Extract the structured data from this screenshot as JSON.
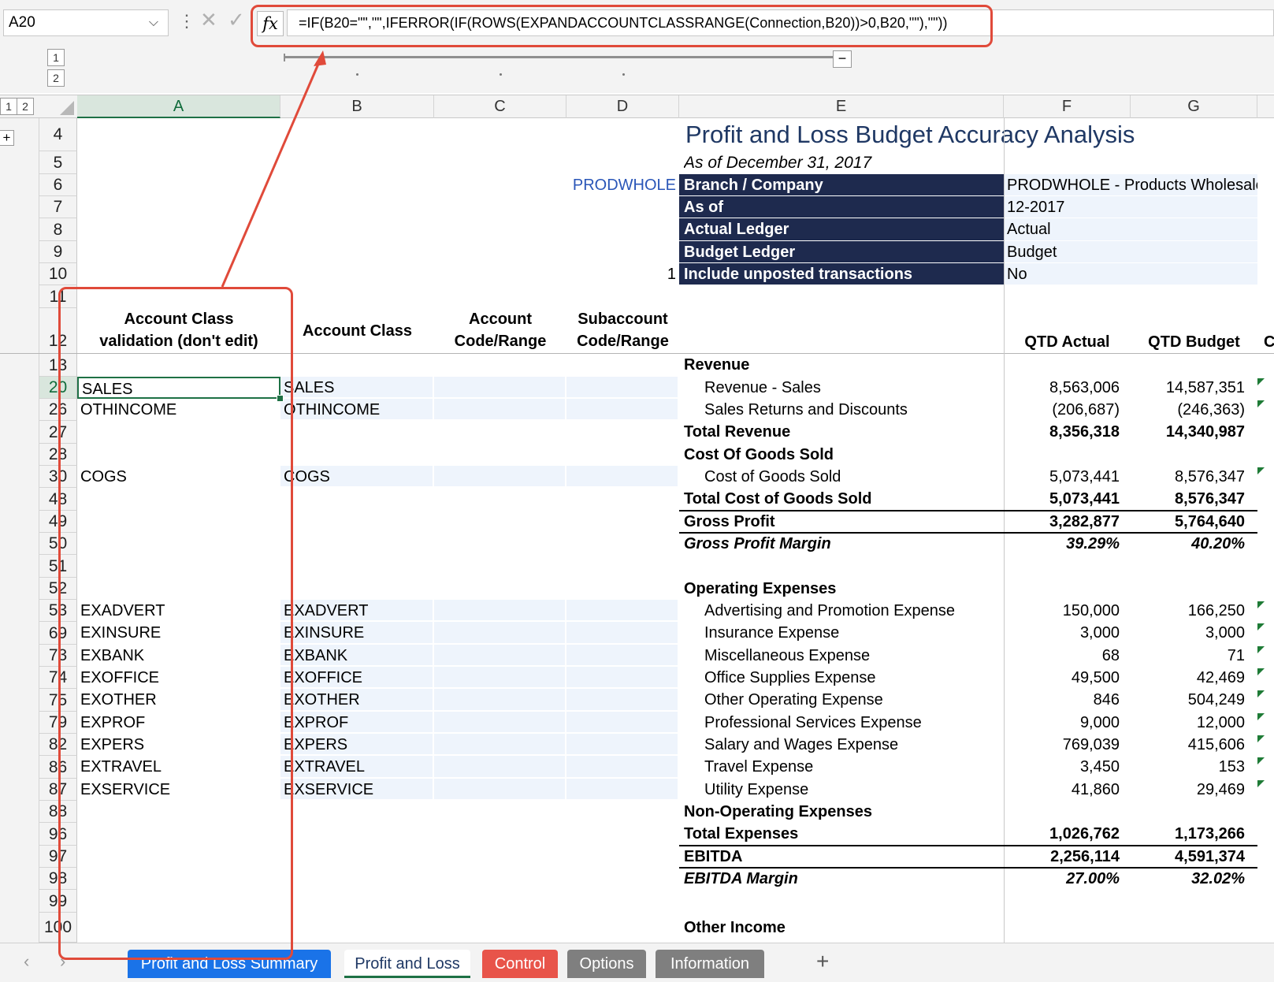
{
  "formula_bar": {
    "name_box": "A20",
    "formula": "=IF(B20=\"\",\"\",IFERROR(IF(ROWS(EXPANDACCOUNTCLASSRANGE(Connection,B20))>0,B20,\"\"),\"\"))",
    "fx_label": "fx",
    "cancel_glyph": "✕",
    "enter_glyph": "✓",
    "more_glyph": "⋮",
    "dropdown_glyph": "⌵"
  },
  "outline": {
    "row_levels": [
      "1",
      "2"
    ],
    "col_levels": [
      "1",
      "2"
    ],
    "collapse_glyph": "−",
    "expand_glyph": "+"
  },
  "columns": [
    "A",
    "B",
    "C",
    "D",
    "E",
    "F",
    "G"
  ],
  "row_numbers": [
    "4",
    "5",
    "6",
    "7",
    "8",
    "9",
    "10",
    "11",
    "12",
    "13",
    "20",
    "26",
    "27",
    "28",
    "30",
    "48",
    "49",
    "50",
    "51",
    "52",
    "53",
    "69",
    "73",
    "74",
    "75",
    "79",
    "82",
    "86",
    "87",
    "88",
    "96",
    "97",
    "98",
    "99",
    "100"
  ],
  "report": {
    "title": "Profit and Loss Budget Accuracy Analysis",
    "subtitle": "As of December 31, 2017",
    "branch_code": "PRODWHOLE",
    "d10_value": "1",
    "params": [
      {
        "label": "Branch / Company",
        "value": "PRODWHOLE - Products Wholesale"
      },
      {
        "label": "As of",
        "value": "12-2017"
      },
      {
        "label": "Actual Ledger",
        "value": "Actual"
      },
      {
        "label": "Budget Ledger",
        "value": "Budget"
      },
      {
        "label": "Include unposted transactions",
        "value": "No"
      }
    ],
    "headers": {
      "a_line1": "Account Class",
      "a_line2": "validation (don't edit)",
      "b": "Account Class",
      "c_line1": "Account",
      "c_line2": "Code/Range",
      "d_line1": "Subaccount",
      "d_line2": "Code/Range",
      "f": "QTD Actual",
      "g": "QTD Budget",
      "h_partial": "C"
    }
  },
  "rows": {
    "r13": {
      "e": "Revenue"
    },
    "r20": {
      "a": "SALES",
      "b": "SALES",
      "e": "Revenue - Sales",
      "f": "8,563,006",
      "g": "14,587,351"
    },
    "r26": {
      "a": "OTHINCOME",
      "b": "OTHINCOME",
      "e": "Sales Returns and Discounts",
      "f": "(206,687)",
      "g": "(246,363)"
    },
    "r27": {
      "e": "Total Revenue",
      "f": "8,356,318",
      "g": "14,340,987"
    },
    "r28": {
      "e": "Cost Of Goods Sold"
    },
    "r30": {
      "a": "COGS",
      "b": "COGS",
      "e": "Cost of Goods Sold",
      "f": "5,073,441",
      "g": "8,576,347"
    },
    "r48": {
      "e": "Total Cost of Goods Sold",
      "f": "5,073,441",
      "g": "8,576,347"
    },
    "r49": {
      "e": "Gross Profit",
      "f": "3,282,877",
      "g": "5,764,640"
    },
    "r50": {
      "e": "Gross Profit Margin",
      "f": "39.29%",
      "g": "40.20%"
    },
    "r52": {
      "e": "Operating Expenses"
    },
    "r53": {
      "a": "EXADVERT",
      "b": "EXADVERT",
      "e": "Advertising and Promotion Expense",
      "f": "150,000",
      "g": "166,250"
    },
    "r69": {
      "a": "EXINSURE",
      "b": "EXINSURE",
      "e": "Insurance Expense",
      "f": "3,000",
      "g": "3,000"
    },
    "r73": {
      "a": "EXBANK",
      "b": "EXBANK",
      "e": "Miscellaneous Expense",
      "f": "68",
      "g": "71"
    },
    "r74": {
      "a": "EXOFFICE",
      "b": "EXOFFICE",
      "e": "Office Supplies Expense",
      "f": "49,500",
      "g": "42,469"
    },
    "r75": {
      "a": "EXOTHER",
      "b": "EXOTHER",
      "e": "Other Operating Expense",
      "f": "846",
      "g": "504,249"
    },
    "r79": {
      "a": "EXPROF",
      "b": "EXPROF",
      "e": "Professional Services Expense",
      "f": "9,000",
      "g": "12,000"
    },
    "r82": {
      "a": "EXPERS",
      "b": "EXPERS",
      "e": "Salary and Wages Expense",
      "f": "769,039",
      "g": "415,606"
    },
    "r86": {
      "a": "EXTRAVEL",
      "b": "EXTRAVEL",
      "e": "Travel Expense",
      "f": "3,450",
      "g": "153"
    },
    "r87": {
      "a": "EXSERVICE",
      "b": "EXSERVICE",
      "e": "Utility Expense",
      "f": "41,860",
      "g": "29,469"
    },
    "r88": {
      "e": "Non-Operating Expenses"
    },
    "r96": {
      "e": "Total Expenses",
      "f": "1,026,762",
      "g": "1,173,266"
    },
    "r97": {
      "e": "EBITDA",
      "f": "2,256,114",
      "g": "4,591,374"
    },
    "r98": {
      "e": "EBITDA Margin",
      "f": "27.00%",
      "g": "32.02%"
    },
    "r100": {
      "e": "Other Income"
    }
  },
  "sheet_tabs": [
    {
      "label": "Profit and Loss Summary",
      "color": "#1a73e8",
      "active": false
    },
    {
      "label": "Profit and Loss",
      "color": "#ffffff",
      "active": true
    },
    {
      "label": "Control",
      "color": "#e8544a",
      "active": false
    },
    {
      "label": "Options",
      "color": "#7f7f7f",
      "active": false
    },
    {
      "label": "Information",
      "color": "#7f7f7f",
      "active": false
    }
  ],
  "tab_nav": {
    "prev": "‹",
    "next": "›",
    "add": "+"
  },
  "colors": {
    "accent_green": "#1e7145",
    "header_navy": "#1e2a4e",
    "annotation_red": "#e04a3a",
    "title_blue": "#1f3864"
  }
}
